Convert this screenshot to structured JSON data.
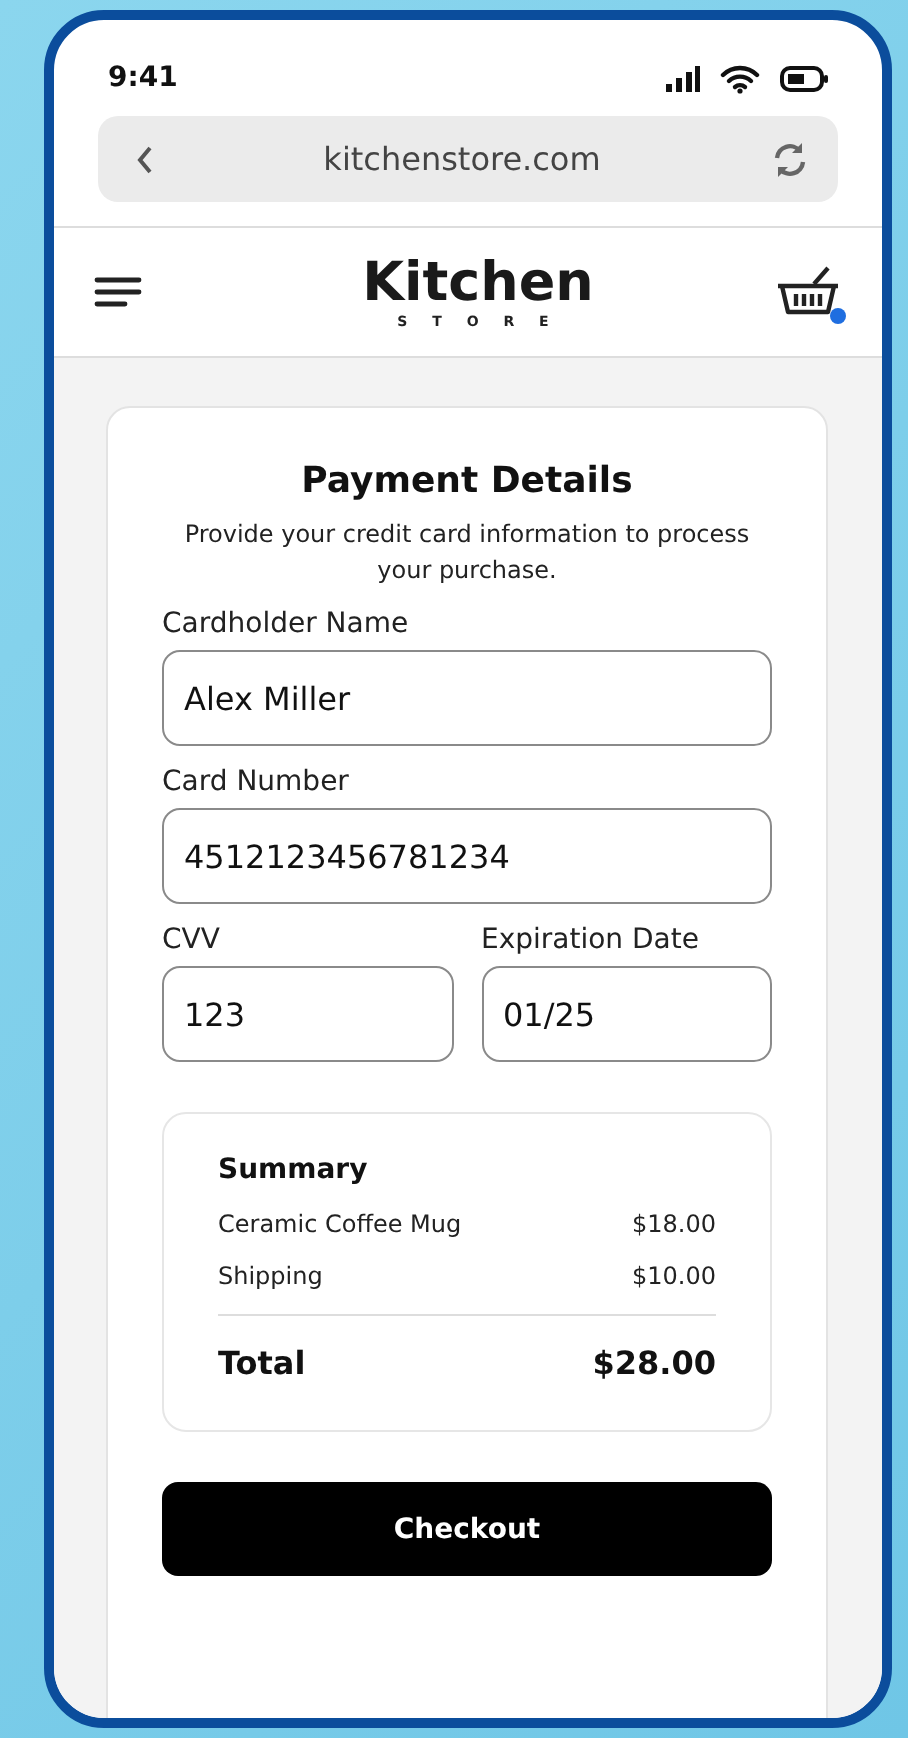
{
  "status_bar": {
    "time": "9:41"
  },
  "browser": {
    "url": "kitchenstore.com"
  },
  "header": {
    "logo": "Kitchen",
    "logo_sub": "S T O R E",
    "cart_dot": true
  },
  "payment": {
    "title": "Payment Details",
    "subtitle": "Provide your credit card information to process your purchase.",
    "fields": [
      {
        "label": "Cardholder Name",
        "value": "Alex Miller",
        "half": false
      },
      {
        "label": "Card Number",
        "value": "4512123456781234",
        "half": false
      },
      {
        "label": "CVV",
        "value": "123",
        "half": true
      },
      {
        "label": "Expiration Date",
        "value": "01/25",
        "half": true
      }
    ],
    "summary": {
      "title": "Summary",
      "lines": [
        {
          "label": "Ceramic Coffee Mug",
          "amount": "$18.00"
        },
        {
          "label": "Shipping",
          "amount": "$10.00"
        }
      ],
      "total_label": "Total",
      "total": "$28.00"
    },
    "button": "Checkout"
  }
}
